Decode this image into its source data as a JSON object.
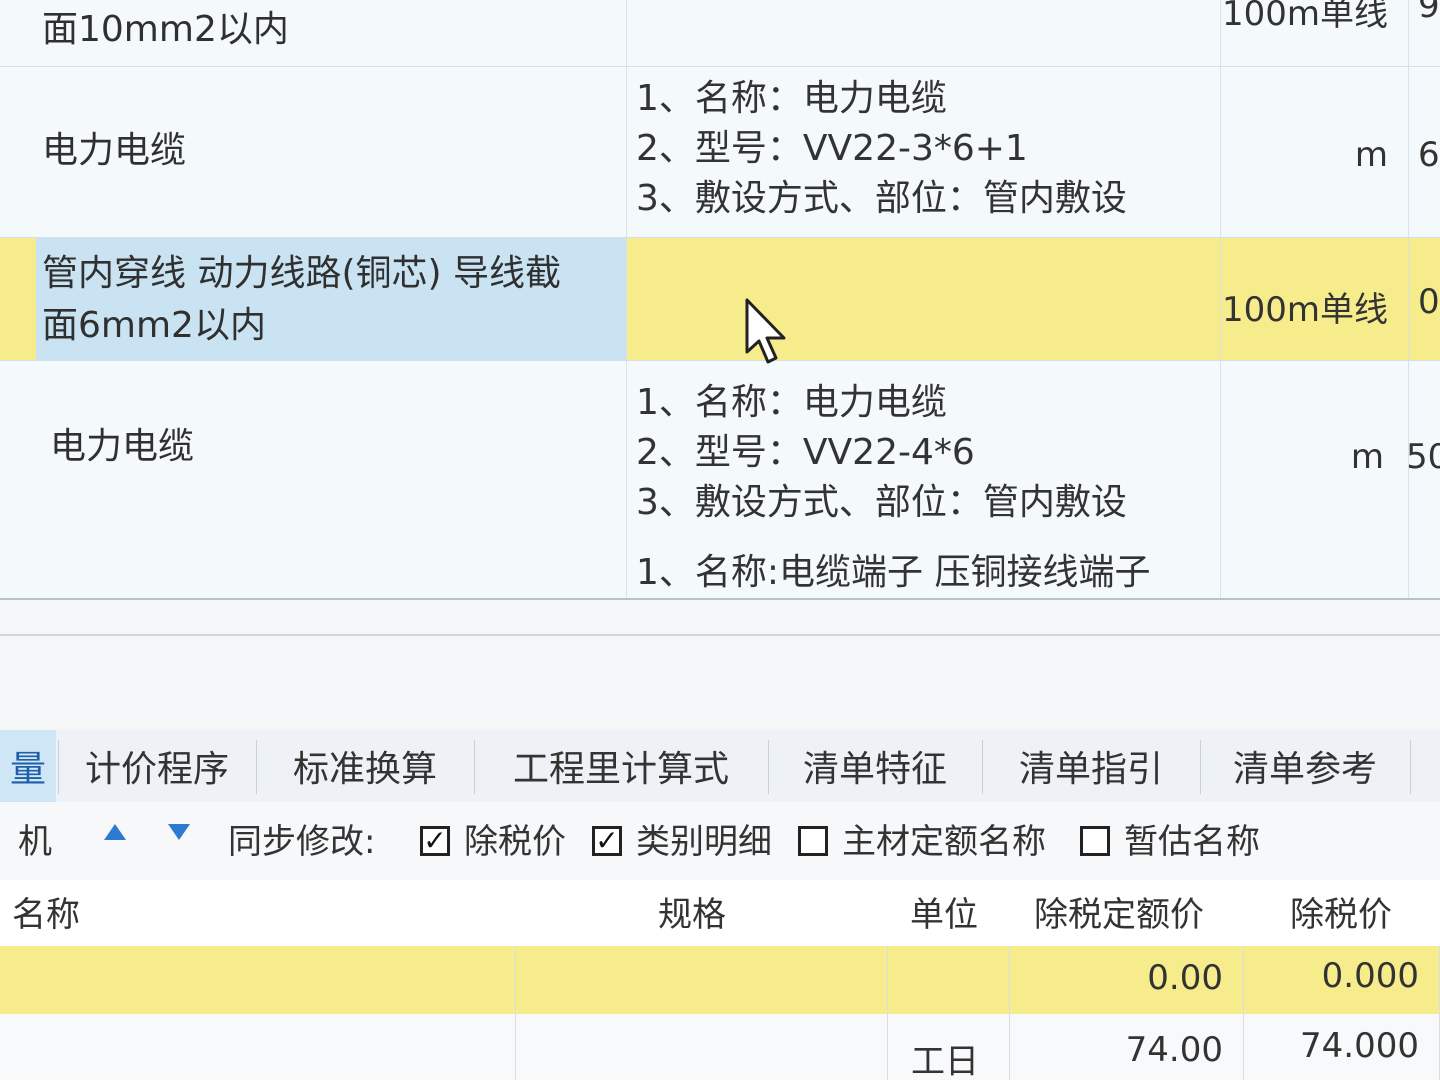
{
  "grid": {
    "rows": [
      {
        "name_lines": [
          "面10mm2以内"
        ],
        "feature_lines": [],
        "unit": "100m单线",
        "qty": "9"
      },
      {
        "name_lines": [
          "电力电缆"
        ],
        "feature_lines": [
          "1、名称：电力电缆",
          "2、型号：VV22-3*6+1",
          "3、敷设方式、部位：管内敷设"
        ],
        "unit": "m",
        "qty": "6"
      },
      {
        "name_lines": [
          "管内穿线 动力线路(铜芯) 导线截",
          "面6mm2以内"
        ],
        "feature_lines": [],
        "unit": "100m单线",
        "qty": "0"
      },
      {
        "name_lines": [
          "电力电缆"
        ],
        "feature_lines": [
          "1、名称：电力电缆",
          "2、型号：VV22-4*6",
          "3、敷设方式、部位：管内敷设"
        ],
        "unit": "m",
        "qty": "50"
      },
      {
        "name_lines": [],
        "feature_lines": [
          "1、名称:电缆端子 压铜接线端子"
        ],
        "unit": "",
        "qty": ""
      }
    ]
  },
  "tabs": [
    {
      "label": "量",
      "active": true
    },
    {
      "label": "计价程序"
    },
    {
      "label": "标准换算"
    },
    {
      "label": "工程里计算式"
    },
    {
      "label": "清单特征"
    },
    {
      "label": "清单指引"
    },
    {
      "label": "清单参考"
    }
  ],
  "toolbar": {
    "left_label": "机",
    "sync_label": "同步修改:",
    "checkboxes": [
      {
        "label": "除税价",
        "checked": true
      },
      {
        "label": "类别明细",
        "checked": true
      },
      {
        "label": "主材定额名称",
        "checked": false
      },
      {
        "label": "暂估名称",
        "checked": false
      }
    ]
  },
  "table": {
    "headers": {
      "name": "名称",
      "spec": "规格",
      "unit": "单位",
      "quota_price": "除税定额价",
      "price": "除税价"
    },
    "rows": [
      {
        "name": "",
        "spec": "",
        "unit": "",
        "quota_price": "0.00",
        "price": "0.000"
      },
      {
        "name": "",
        "spec": "",
        "unit": "工日",
        "quota_price": "74.00",
        "price": "74.000"
      }
    ]
  },
  "colors": {
    "selected_blue": "#c9e3f3",
    "selected_yellow": "#f7ec8c",
    "accent": "#2e7ad1"
  }
}
